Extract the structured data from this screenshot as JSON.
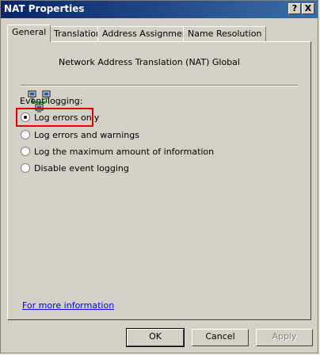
{
  "window": {
    "title": "NAT Properties"
  },
  "titlebar_buttons": {
    "help": "?",
    "close": "X"
  },
  "tabs": [
    {
      "label": "General"
    },
    {
      "label": "Translation"
    },
    {
      "label": "Address Assignment"
    },
    {
      "label": "Name Resolution"
    }
  ],
  "header": {
    "description": "Network Address Translation (NAT) Global"
  },
  "event_logging": {
    "label": "Event logging:",
    "options": [
      {
        "label": "Log errors only",
        "selected": true
      },
      {
        "label": "Log errors and warnings",
        "selected": false
      },
      {
        "label": "Log the maximum amount of information",
        "selected": false
      },
      {
        "label": "Disable event logging",
        "selected": false
      }
    ]
  },
  "more_info_link": "For more information",
  "buttons": {
    "ok": "OK",
    "cancel": "Cancel",
    "apply": "Apply"
  },
  "icon": "network-computers-icon"
}
